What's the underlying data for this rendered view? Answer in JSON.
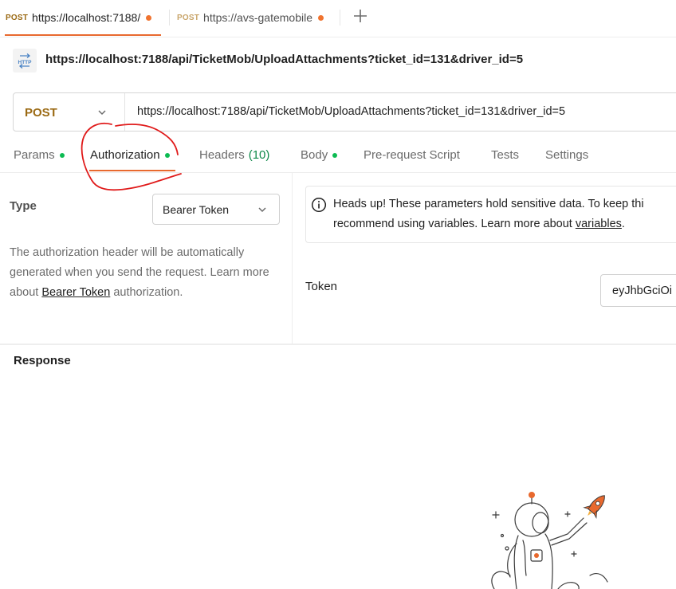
{
  "tabs": [
    {
      "method": "POST",
      "url": "https://localhost:7188/",
      "unsaved": true,
      "active": true
    },
    {
      "method": "POST",
      "url": "https://avs-gatemobile",
      "unsaved": true,
      "active": false
    }
  ],
  "request": {
    "title": "https://localhost:7188/api/TicketMob/UploadAttachments?ticket_id=131&driver_id=5",
    "method": "POST",
    "url": "https://localhost:7188/api/TicketMob/UploadAttachments?ticket_id=131&driver_id=5"
  },
  "request_tabs": {
    "params": "Params",
    "authorization": "Authorization",
    "headers": "Headers",
    "headers_count": "(10)",
    "body": "Body",
    "prerequest": "Pre-request Script",
    "tests": "Tests",
    "settings": "Settings"
  },
  "auth": {
    "type_label": "Type",
    "type_value": "Bearer Token",
    "desc_1": "The authorization header will be automatically generated when you send the request. Learn more about ",
    "desc_link": "Bearer Token",
    "desc_2": " authorization.",
    "notice_1": "Heads up! These parameters hold sensitive data. To keep thi",
    "notice_2": "recommend using variables. Learn more about ",
    "notice_link": "variables",
    "notice_3": ".",
    "token_label": "Token",
    "token_value": "eyJhbGciOi"
  },
  "response": {
    "title": "Response"
  },
  "icons": {
    "http": "http-request-icon",
    "info": "info-icon",
    "chevron": "chevron-down-icon",
    "plus": "plus-icon",
    "illustration": "astronaut-rocket-illustration"
  },
  "colors": {
    "post": "#9b6a14",
    "accent": "#e8692e",
    "status_dot": "#0cbb52",
    "annotation": "#e01b1b"
  }
}
